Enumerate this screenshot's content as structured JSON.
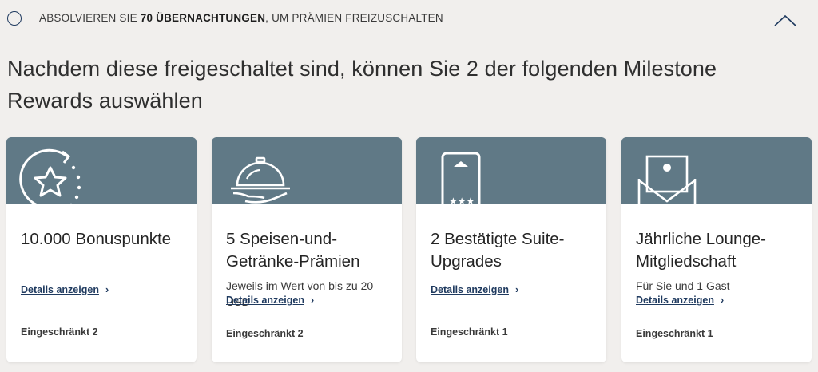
{
  "milestone": {
    "goal_prefix": "ABSOLVIEREN SIE ",
    "goal_bold": "70 ÜBERNACHTUNGEN",
    "goal_suffix": ", UM PRÄMIEN FREIZUSCHALTEN"
  },
  "headline": "Nachdem diese freigeschaltet sind, können Sie 2 der folgenden Milestone Rewards auswählen",
  "cards": [
    {
      "title": "10.000 Bonuspunkte",
      "subtitle": "",
      "link": "Details anzeigen",
      "footer": "Eingeschränkt 2",
      "icon": "star-refresh-icon"
    },
    {
      "title": "5 Speisen-und-Getränke-Prämien",
      "subtitle": "Jeweils im Wert von bis zu 20 USD",
      "link": "Details anzeigen",
      "footer": "Eingeschränkt 2",
      "icon": "food-cloche-icon"
    },
    {
      "title": "2 Bestätigte Suite-Upgrades",
      "subtitle": "",
      "link": "Details anzeigen",
      "footer": "Eingeschränkt 1",
      "icon": "keycard-icon"
    },
    {
      "title": "Jährliche Lounge-Mitgliedschaft",
      "subtitle": "Für Sie und 1 Gast",
      "link": "Details anzeigen",
      "footer": "Eingeschränkt 1",
      "icon": "envelope-invite-icon"
    }
  ],
  "colors": {
    "background": "#f1efed",
    "banner": "#607986",
    "link": "#1f3a5f"
  }
}
